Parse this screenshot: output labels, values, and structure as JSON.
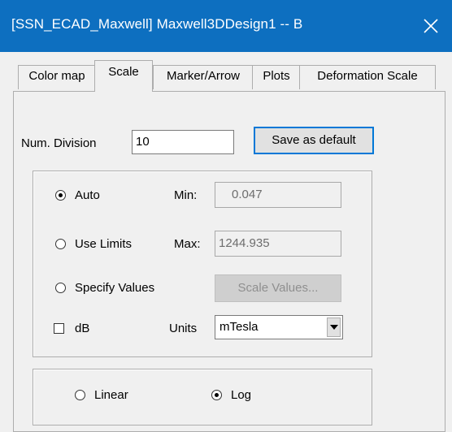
{
  "window": {
    "title": "[SSN_ECAD_Maxwell] Maxwell3DDesign1 -- B",
    "close_icon": "close-icon"
  },
  "tabs": [
    {
      "label": "Color map"
    },
    {
      "label": "Scale"
    },
    {
      "label": "Marker/Arrow"
    },
    {
      "label": "Plots"
    },
    {
      "label": "Deformation Scale"
    }
  ],
  "active_tab": "Scale",
  "num_division": {
    "label": "Num. Division",
    "value": "10"
  },
  "save_default_button": "Save as default",
  "range": {
    "auto_label": "Auto",
    "use_limits_label": "Use Limits",
    "specify_values_label": "Specify Values",
    "selected": "Auto",
    "min_label": "Min:",
    "min_value": "0.047",
    "max_label": "Max:",
    "max_value": "1244.935",
    "scale_values_button": "Scale Values...",
    "db_label": "dB",
    "db_checked": false,
    "units_label": "Units",
    "units_value": "mTesla"
  },
  "scale_type": {
    "linear_label": "Linear",
    "log_label": "Log",
    "selected": "Log"
  }
}
